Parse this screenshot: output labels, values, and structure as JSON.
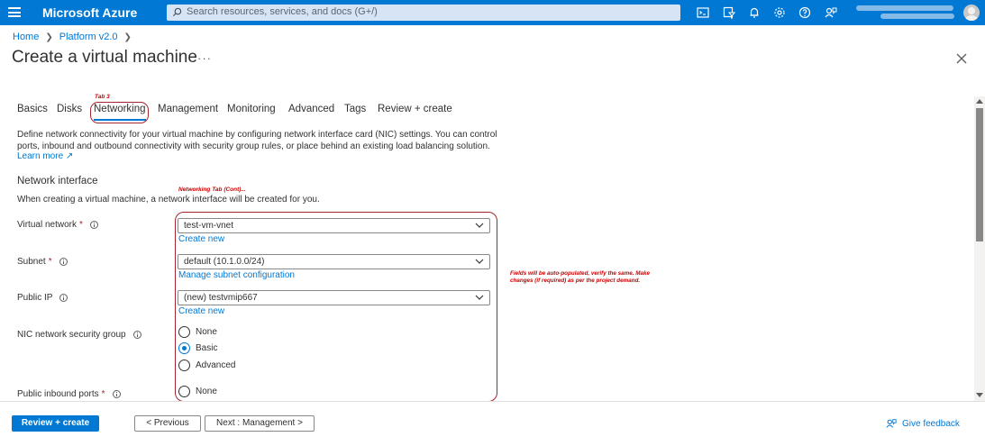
{
  "topbar": {
    "brand": "Microsoft Azure",
    "search_placeholder": "Search resources, services, and docs (G+/)",
    "icons": [
      "menu-icon",
      "cloud-shell-icon",
      "directory-filter-icon",
      "notifications-icon",
      "settings-icon",
      "help-icon",
      "feedback-icon"
    ]
  },
  "breadcrumb": {
    "items": [
      "Home",
      "Platform v2.0"
    ]
  },
  "page": {
    "title": "Create a virtual machine",
    "more": "···"
  },
  "annotations": {
    "tab": "Tab 3",
    "networking": "Networking Tab (Cont)...",
    "fields": "Fields will be auto-populated, verify the same. Make changes (if required) as per the project demand.",
    "color": "#cc0000"
  },
  "tabs": [
    {
      "label": "Basics"
    },
    {
      "label": "Disks"
    },
    {
      "label": "Networking"
    },
    {
      "label": "Management"
    },
    {
      "label": "Monitoring"
    },
    {
      "label": "Advanced"
    },
    {
      "label": "Tags"
    },
    {
      "label": "Review + create"
    }
  ],
  "intro": {
    "text": "Define network connectivity for your virtual machine by configuring network interface card (NIC) settings. You can control ports, inbound and outbound connectivity with security group rules, or place behind an existing load balancing solution.",
    "learn_more": "Learn more"
  },
  "section": {
    "title": "Network interface",
    "subtitle": "When creating a virtual machine, a network interface will be created for you."
  },
  "fields": {
    "vnet": {
      "label": "Virtual network",
      "required": "*",
      "value": "test-vm-vnet",
      "link": "Create new"
    },
    "subnet": {
      "label": "Subnet",
      "required": "*",
      "value": "default (10.1.0.0/24)",
      "link": "Manage subnet configuration"
    },
    "public_ip": {
      "label": "Public IP",
      "value": "(new) testvmip667",
      "link": "Create new"
    },
    "nsg": {
      "label": "NIC network security group",
      "options": [
        "None",
        "Basic",
        "Advanced"
      ],
      "selected": "Basic"
    },
    "inbound": {
      "label": "Public inbound ports",
      "required": "*",
      "options": [
        "None"
      ]
    }
  },
  "footer": {
    "review": "Review + create",
    "previous": "< Previous",
    "next": "Next : Management >",
    "feedback": "Give feedback"
  },
  "colors": {
    "accent": "#0078d4",
    "header": "#0078d4",
    "annotation": "#a4262c"
  }
}
